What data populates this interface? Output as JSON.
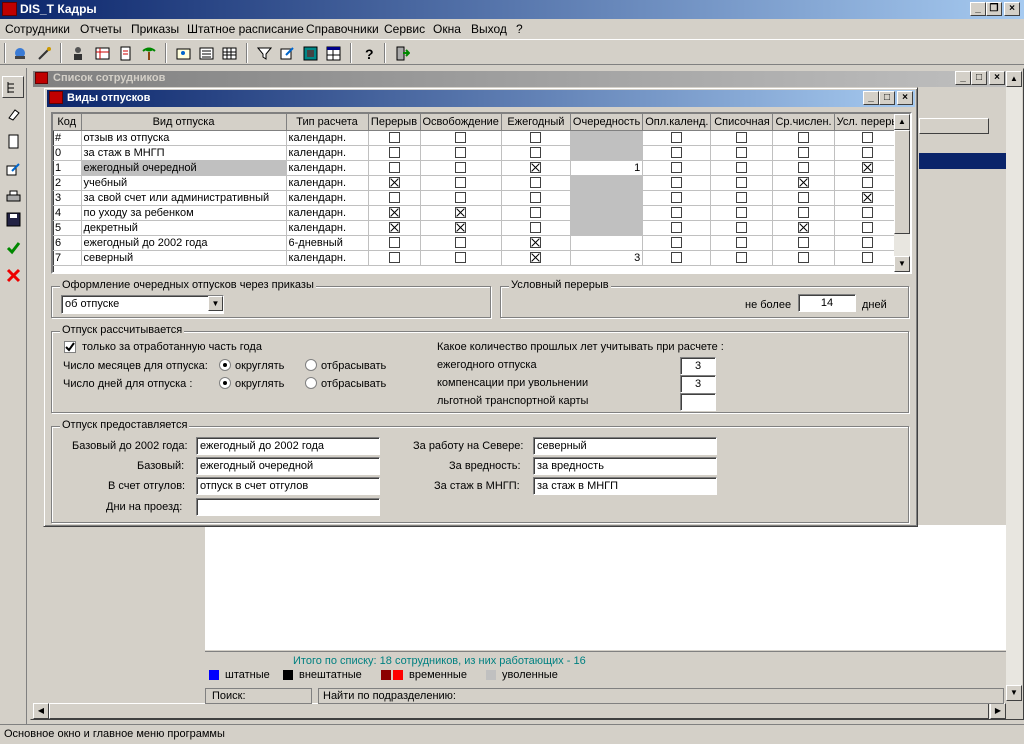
{
  "app": {
    "title": "DIS_T Кадры"
  },
  "menu": [
    "Сотрудники",
    "Отчеты",
    "Приказы",
    "Штатное расписание",
    "Справочники",
    "Сервис",
    "Окна",
    "Выход",
    "?"
  ],
  "emp_window": {
    "title": "Список сотрудников"
  },
  "dialog": {
    "title": "Виды отпусков",
    "columns": [
      "Код",
      "Вид отпуска",
      "Тип расчета",
      "Перерыв",
      "Освобождение",
      "Ежегодный",
      "Очередность",
      "Опл.календ.",
      "Списочная",
      "Ср.числен.",
      "Усл. переры"
    ],
    "rows": [
      {
        "code": "#",
        "name": "отзыв из отпуска",
        "calc": "календарн.",
        "flags": [
          0,
          0,
          0,
          "g",
          0,
          0,
          0,
          0
        ]
      },
      {
        "code": "0",
        "name": "за стаж в МНГП",
        "calc": "календарн.",
        "flags": [
          0,
          0,
          0,
          "g",
          0,
          0,
          0,
          0
        ]
      },
      {
        "code": "1",
        "name": "ежегодный очередной",
        "calc": "календарн.",
        "flags": [
          0,
          0,
          1,
          "1",
          0,
          0,
          0,
          1
        ]
      },
      {
        "code": "2",
        "name": "учебный",
        "calc": "календарн.",
        "flags": [
          1,
          0,
          0,
          "g",
          0,
          0,
          1,
          0
        ]
      },
      {
        "code": "3",
        "name": "за свой счет или административный",
        "calc": "календарн.",
        "flags": [
          0,
          0,
          0,
          "g",
          0,
          0,
          0,
          1
        ]
      },
      {
        "code": "4",
        "name": "по уходу за ребенком",
        "calc": "календарн.",
        "flags": [
          1,
          1,
          0,
          "g",
          0,
          0,
          0,
          0
        ]
      },
      {
        "code": "5",
        "name": "декретный",
        "calc": "календарн.",
        "flags": [
          1,
          1,
          0,
          "g",
          0,
          0,
          1,
          0
        ]
      },
      {
        "code": "6",
        "name": "ежегодный до 2002 года",
        "calc": "6-дневный",
        "flags": [
          0,
          0,
          1,
          "",
          0,
          0,
          0,
          0
        ]
      },
      {
        "code": "7",
        "name": "северный",
        "calc": "календарн.",
        "flags": [
          0,
          0,
          1,
          "3",
          0,
          0,
          0,
          0
        ]
      }
    ],
    "orders_group": {
      "title": "Оформление очередных отпусков через приказы",
      "select_value": "об отпуске"
    },
    "break_group": {
      "title": "Условный перерыв",
      "label_before": "не более",
      "value": "14",
      "label_after": "дней"
    },
    "calc_group": {
      "title": "Отпуск рассчитывается",
      "checkbox_label": "только за отработанную часть года",
      "months_label": "Число месяцев для отпуска:",
      "days_label": "Число дней для отпуска :",
      "opt_round": "округлять",
      "opt_drop": "отбрасывать",
      "years_title": "Какое количество прошлых лет учитывать при расчете :",
      "years_annual_label": "ежегодного отпуска",
      "years_annual_value": "3",
      "years_comp_label": "компенсации при увольнении",
      "years_comp_value": "3",
      "years_transport_label": "льготной транспортной карты",
      "years_transport_value": ""
    },
    "grant_group": {
      "title": "Отпуск предоставляется",
      "base2002_label": "Базовый до 2002 года:",
      "base2002_value": "ежегодный до 2002 года",
      "base_label": "Базовый:",
      "base_value": "ежегодный очередной",
      "timeoff_label": "В счет отгулов:",
      "timeoff_value": "отпуск в счет отгулов",
      "travel_label": "Дни на проезд:",
      "travel_value": "",
      "north_label": "За работу на Севере:",
      "north_value": "северный",
      "harm_label": "За вредность:",
      "harm_value": "за вредность",
      "mngp_label": "За стаж в МНГП:",
      "mngp_value": "за стаж в МНГП"
    }
  },
  "list_footer": {
    "summary": "Итого по списку: 18 сотрудников, из них работающих - 16",
    "legend": [
      {
        "label": "штатные",
        "colors": [
          "#0000ff"
        ]
      },
      {
        "label": "внештатные",
        "colors": [
          "#000000"
        ]
      },
      {
        "label": "временные",
        "colors": [
          "#8b0000",
          "#ff0000"
        ]
      },
      {
        "label": "уволенные",
        "colors": [
          "#c0c0c0"
        ]
      }
    ],
    "search_label": "Поиск:",
    "dept_search_label": "Найти по подразделению:"
  },
  "status": {
    "text": "Основное окно и главное меню программы"
  }
}
